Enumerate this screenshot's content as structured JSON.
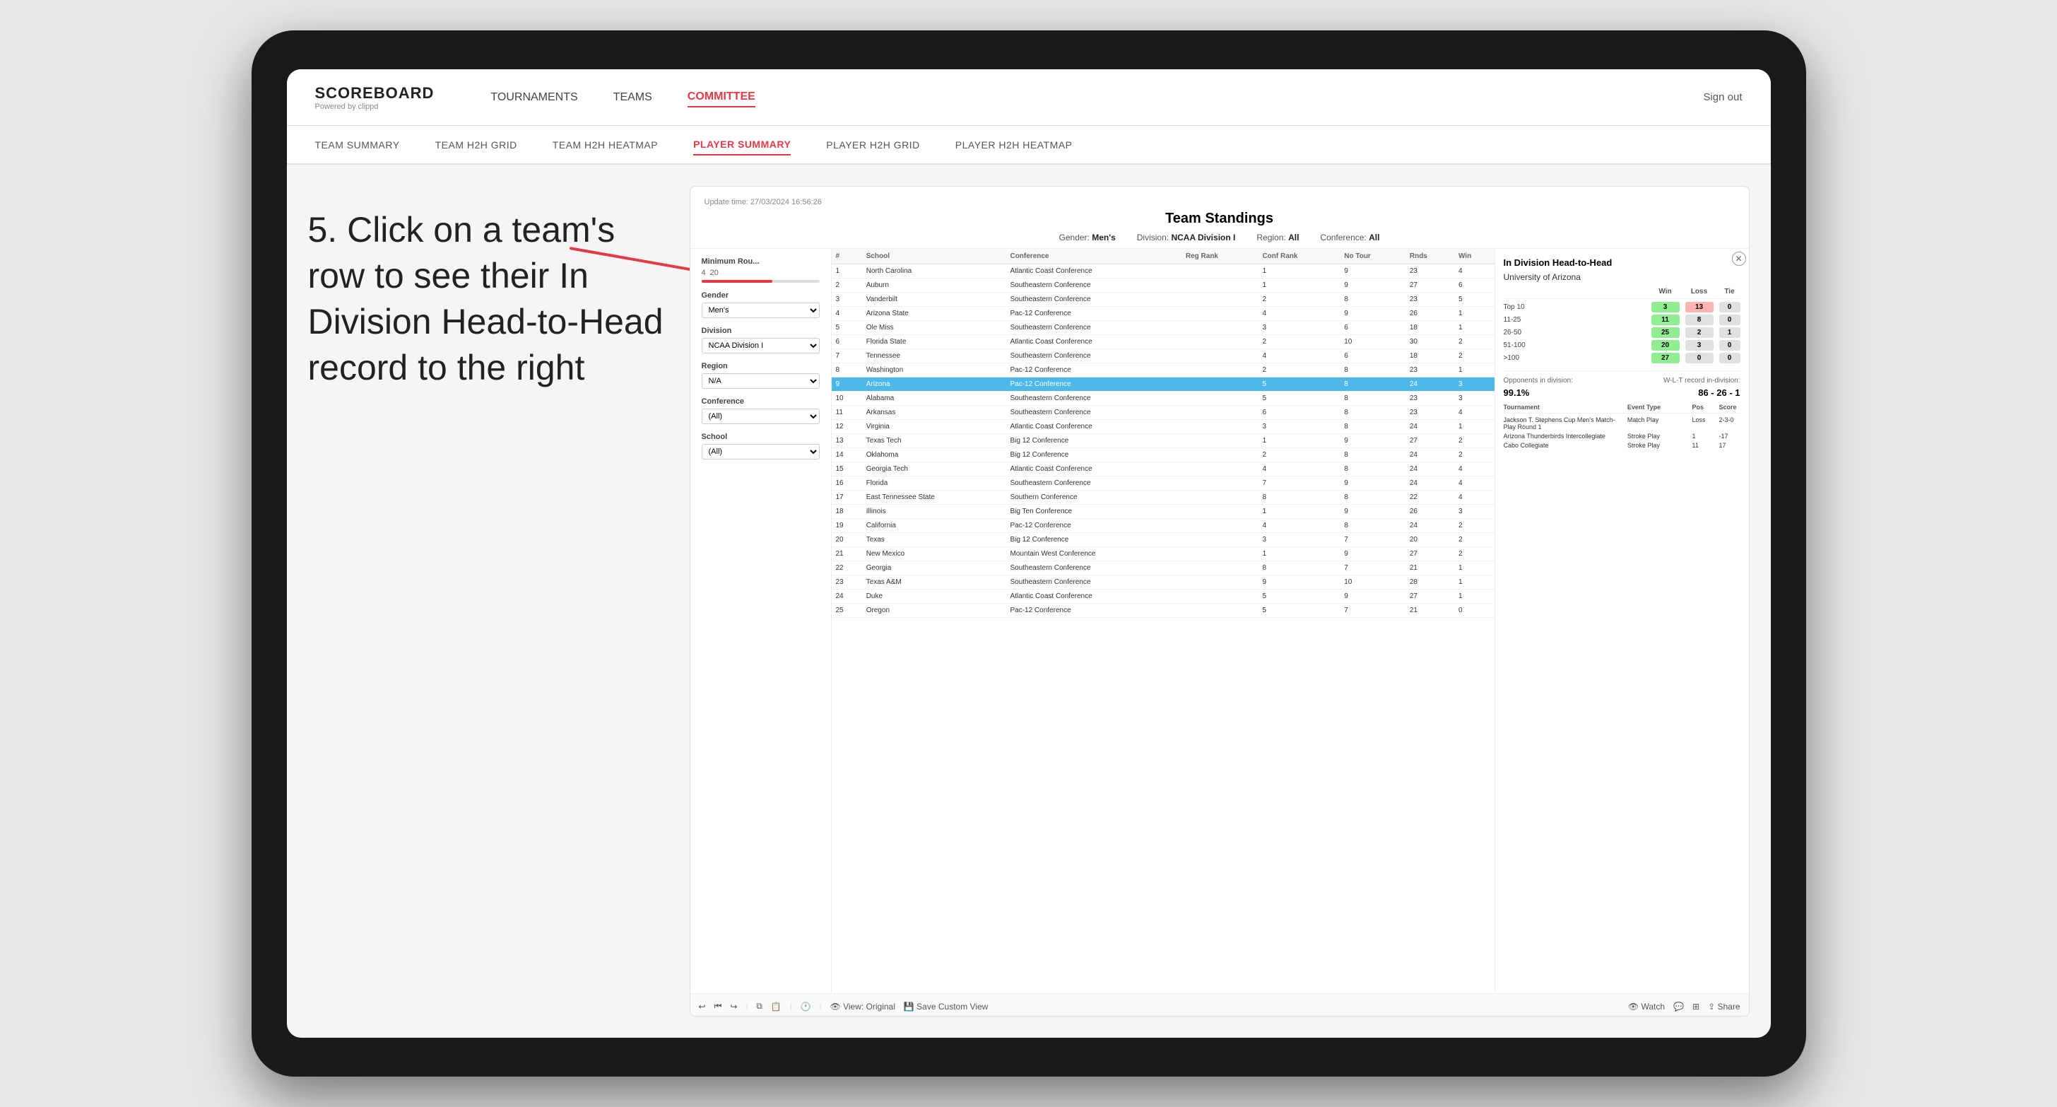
{
  "tablet": {
    "nav": {
      "logo": "SCOREBOARD",
      "logo_sub": "Powered by clippd",
      "links": [
        "TOURNAMENTS",
        "TEAMS",
        "COMMITTEE"
      ],
      "active_link": "COMMITTEE",
      "sign_out": "Sign out"
    },
    "sub_nav": {
      "links": [
        "TEAM SUMMARY",
        "TEAM H2H GRID",
        "TEAM H2H HEATMAP",
        "PLAYER SUMMARY",
        "PLAYER H2H GRID",
        "PLAYER H2H HEATMAP"
      ],
      "active_link": "PLAYER SUMMARY"
    },
    "scoreboard": {
      "update_time": "Update time: 27/03/2024 16:56:26",
      "title": "Team Standings",
      "filters": {
        "gender": "Men's",
        "division": "NCAA Division I",
        "region": "All",
        "conference": "All"
      },
      "left_filters": {
        "min_rounds_label": "Minimum Rou...",
        "min_rounds_min": 4,
        "min_rounds_max": 20,
        "gender_label": "Gender",
        "gender_value": "Men's",
        "division_label": "Division",
        "division_value": "NCAA Division I",
        "region_label": "Region",
        "region_value": "N/A",
        "conference_label": "Conference",
        "conference_value": "(All)",
        "school_label": "School",
        "school_value": "(All)"
      },
      "table": {
        "headers": [
          "#",
          "School",
          "Conference",
          "Reg Rank",
          "Conf Rank",
          "No Tour",
          "Rnds",
          "Win"
        ],
        "rows": [
          {
            "num": 1,
            "school": "North Carolina",
            "conference": "Atlantic Coast Conference",
            "reg_rank": "",
            "conf_rank": 1,
            "no_tour": 9,
            "rnds": 23,
            "win": 4
          },
          {
            "num": 2,
            "school": "Auburn",
            "conference": "Southeastern Conference",
            "reg_rank": "",
            "conf_rank": 1,
            "no_tour": 9,
            "rnds": 27,
            "win": 6
          },
          {
            "num": 3,
            "school": "Vanderbilt",
            "conference": "Southeastern Conference",
            "reg_rank": "",
            "conf_rank": 2,
            "no_tour": 8,
            "rnds": 23,
            "win": 5
          },
          {
            "num": 4,
            "school": "Arizona State",
            "conference": "Pac-12 Conference",
            "reg_rank": "",
            "conf_rank": 4,
            "no_tour": 9,
            "rnds": 26,
            "win": 1
          },
          {
            "num": 5,
            "school": "Ole Miss",
            "conference": "Southeastern Conference",
            "reg_rank": "",
            "conf_rank": 3,
            "no_tour": 6,
            "rnds": 18,
            "win": 1
          },
          {
            "num": 6,
            "school": "Florida State",
            "conference": "Atlantic Coast Conference",
            "reg_rank": "",
            "conf_rank": 2,
            "no_tour": 10,
            "rnds": 30,
            "win": 2
          },
          {
            "num": 7,
            "school": "Tennessee",
            "conference": "Southeastern Conference",
            "reg_rank": "",
            "conf_rank": 4,
            "no_tour": 6,
            "rnds": 18,
            "win": 2
          },
          {
            "num": 8,
            "school": "Washington",
            "conference": "Pac-12 Conference",
            "reg_rank": "",
            "conf_rank": 2,
            "no_tour": 8,
            "rnds": 23,
            "win": 1
          },
          {
            "num": 9,
            "school": "Arizona",
            "conference": "Pac-12 Conference",
            "highlighted": true,
            "reg_rank": "",
            "conf_rank": 5,
            "no_tour": 8,
            "rnds": 24,
            "win": 3
          },
          {
            "num": 10,
            "school": "Alabama",
            "conference": "Southeastern Conference",
            "reg_rank": "",
            "conf_rank": 5,
            "no_tour": 8,
            "rnds": 23,
            "win": 3
          },
          {
            "num": 11,
            "school": "Arkansas",
            "conference": "Southeastern Conference",
            "reg_rank": "",
            "conf_rank": 6,
            "no_tour": 8,
            "rnds": 23,
            "win": 4
          },
          {
            "num": 12,
            "school": "Virginia",
            "conference": "Atlantic Coast Conference",
            "reg_rank": "",
            "conf_rank": 3,
            "no_tour": 8,
            "rnds": 24,
            "win": 1
          },
          {
            "num": 13,
            "school": "Texas Tech",
            "conference": "Big 12 Conference",
            "reg_rank": "",
            "conf_rank": 1,
            "no_tour": 9,
            "rnds": 27,
            "win": 2
          },
          {
            "num": 14,
            "school": "Oklahoma",
            "conference": "Big 12 Conference",
            "reg_rank": "",
            "conf_rank": 2,
            "no_tour": 8,
            "rnds": 24,
            "win": 2
          },
          {
            "num": 15,
            "school": "Georgia Tech",
            "conference": "Atlantic Coast Conference",
            "reg_rank": "",
            "conf_rank": 4,
            "no_tour": 8,
            "rnds": 24,
            "win": 4
          },
          {
            "num": 16,
            "school": "Florida",
            "conference": "Southeastern Conference",
            "reg_rank": "",
            "conf_rank": 7,
            "no_tour": 9,
            "rnds": 24,
            "win": 4
          },
          {
            "num": 17,
            "school": "East Tennessee State",
            "conference": "Southern Conference",
            "reg_rank": "",
            "conf_rank": 8,
            "no_tour": 8,
            "rnds": 22,
            "win": 4
          },
          {
            "num": 18,
            "school": "Illinois",
            "conference": "Big Ten Conference",
            "reg_rank": "",
            "conf_rank": 1,
            "no_tour": 9,
            "rnds": 26,
            "win": 3
          },
          {
            "num": 19,
            "school": "California",
            "conference": "Pac-12 Conference",
            "reg_rank": "",
            "conf_rank": 4,
            "no_tour": 8,
            "rnds": 24,
            "win": 2
          },
          {
            "num": 20,
            "school": "Texas",
            "conference": "Big 12 Conference",
            "reg_rank": "",
            "conf_rank": 3,
            "no_tour": 7,
            "rnds": 20,
            "win": 2
          },
          {
            "num": 21,
            "school": "New Mexico",
            "conference": "Mountain West Conference",
            "reg_rank": "",
            "conf_rank": 1,
            "no_tour": 9,
            "rnds": 27,
            "win": 2
          },
          {
            "num": 22,
            "school": "Georgia",
            "conference": "Southeastern Conference",
            "reg_rank": "",
            "conf_rank": 8,
            "no_tour": 7,
            "rnds": 21,
            "win": 1
          },
          {
            "num": 23,
            "school": "Texas A&M",
            "conference": "Southeastern Conference",
            "reg_rank": "",
            "conf_rank": 9,
            "no_tour": 10,
            "rnds": 28,
            "win": 1
          },
          {
            "num": 24,
            "school": "Duke",
            "conference": "Atlantic Coast Conference",
            "reg_rank": "",
            "conf_rank": 5,
            "no_tour": 9,
            "rnds": 27,
            "win": 1
          },
          {
            "num": 25,
            "school": "Oregon",
            "conference": "Pac-12 Conference",
            "reg_rank": "",
            "conf_rank": 5,
            "no_tour": 7,
            "rnds": 21,
            "win": 0
          }
        ]
      },
      "divh2h": {
        "title": "In Division Head-to-Head",
        "team": "University of Arizona",
        "headers": [
          "",
          "Win",
          "Loss",
          "Tie"
        ],
        "rows": [
          {
            "label": "Top 10",
            "win": 3,
            "loss": 13,
            "tie": 0,
            "win_color": "green",
            "loss_color": "red"
          },
          {
            "label": "11-25",
            "win": 11,
            "loss": 8,
            "tie": 0,
            "win_color": "green",
            "loss_color": "grey"
          },
          {
            "label": "26-50",
            "win": 25,
            "loss": 2,
            "tie": 1,
            "win_color": "green",
            "loss_color": "grey"
          },
          {
            "label": "51-100",
            "win": 20,
            "loss": 3,
            "tie": 0,
            "win_color": "green",
            "loss_color": "grey"
          },
          {
            "label": ">100",
            "win": 27,
            "loss": 0,
            "tie": 0,
            "win_color": "green",
            "loss_color": "grey"
          }
        ],
        "opponents_label": "Opponents in division:",
        "opponents_value": "99.1%",
        "record_label": "W-L-T record in-division:",
        "record_value": "86 - 26 - 1",
        "tournaments": {
          "headers": [
            "Tournament",
            "Event Type",
            "Pos",
            "Score"
          ],
          "rows": [
            {
              "name": "Jackson T. Stephens Cup Men's Match-Play Round",
              "type": "Match Play",
              "pos": "Loss",
              "score": "2-3-0"
            },
            {
              "name": "Arizona Thunderbirds Intercollegiate",
              "type": "Stroke Play",
              "pos": "1",
              "score": "-17"
            },
            {
              "name": "Cabo Collegiate",
              "type": "Stroke Play",
              "pos": "11",
              "score": "17"
            }
          ]
        }
      },
      "toolbar": {
        "undo": "↩",
        "redo": "↪",
        "view_original": "View: Original",
        "save_custom": "Save Custom View",
        "watch": "Watch",
        "share": "Share"
      }
    }
  },
  "annotation": {
    "text": "5. Click on a team's row to see their In Division Head-to-Head record to the right"
  }
}
